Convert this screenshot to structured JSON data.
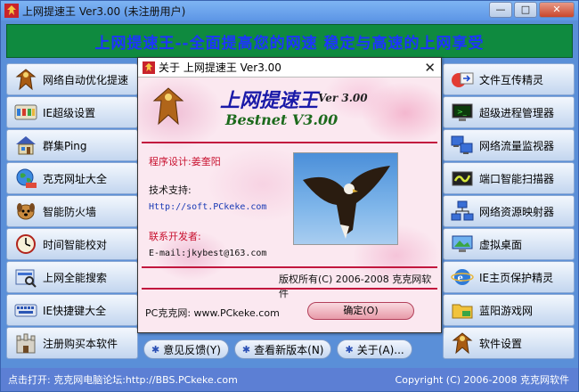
{
  "window": {
    "title": "上网提速王 Ver3.00 (未注册用户)",
    "minimize_glyph": "—",
    "maximize_glyph": "□",
    "close_glyph": "✕"
  },
  "banner": {
    "text": "上网提速王--全面提高您的网速  稳定与高速的上网享受"
  },
  "left_menu": [
    {
      "label": "网络自动优化提速",
      "icon": "eagle-icon"
    },
    {
      "label": "IE超级设置",
      "icon": "ie-toolbar-icon"
    },
    {
      "label": "群集Ping",
      "icon": "house-icon"
    },
    {
      "label": "克克网址大全",
      "icon": "globe-icon"
    },
    {
      "label": "智能防火墙",
      "icon": "dog-icon"
    },
    {
      "label": "时间智能校对",
      "icon": "clock-icon"
    },
    {
      "label": "上网全能搜索",
      "icon": "search-icon"
    },
    {
      "label": "IE快捷键大全",
      "icon": "keyboard-icon"
    },
    {
      "label": "注册购买本软件",
      "icon": "castle-icon"
    }
  ],
  "right_menu": [
    {
      "label": "文件互传精灵",
      "icon": "transfer-icon"
    },
    {
      "label": "超级进程管理器",
      "icon": "monitor-icon"
    },
    {
      "label": "网络流量监视器",
      "icon": "network-monitor-icon"
    },
    {
      "label": "端口智能扫描器",
      "icon": "scanner-icon"
    },
    {
      "label": "网络资源映射器",
      "icon": "network-map-icon"
    },
    {
      "label": "虚拟桌面",
      "icon": "desktop-icon"
    },
    {
      "label": "IE主页保护精灵",
      "icon": "ie-icon"
    },
    {
      "label": "蓝阳游戏网",
      "icon": "folder-icon"
    },
    {
      "label": "软件设置",
      "icon": "eagle-icon"
    }
  ],
  "bottom_buttons": [
    {
      "label": "意见反馈(Y)",
      "icon": "gear-icon"
    },
    {
      "label": "查看新版本(N)",
      "icon": "gear-icon"
    },
    {
      "label": "关于(A)...",
      "icon": "gear-icon"
    }
  ],
  "statusbar": {
    "left": "点击打开: 克克网电脑论坛:http://BBS.PCkeke.com",
    "right": "Copyright (C) 2006-2008 克克网软件"
  },
  "about_dialog": {
    "title": "关于 上网提速王 Ver3.00",
    "close_glyph": "✕",
    "product_name": "上网提速王",
    "version": "Ver 3.00",
    "bestnet": "Bestnet V3.00",
    "designer": "程序设计:姜奎阳",
    "support_label": "技术支持:",
    "support_url": "Http://soft.PCkeke.com",
    "contact_label": "联系开发者:",
    "email": "E-mail:jkybest@163.com",
    "copyright": "版权所有(C) 2006-2008 克克网软件",
    "site": "PC克克网: www.PCkeke.com",
    "ok_label": "确定(O)"
  },
  "colors": {
    "banner_bg": "#0f8a3f",
    "banner_text": "#1d34ff",
    "divider": "#c2173e"
  }
}
